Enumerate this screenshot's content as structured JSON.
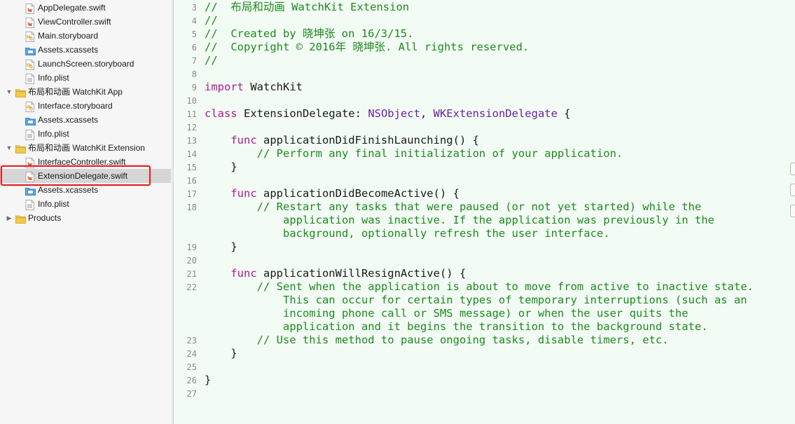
{
  "navigator": {
    "items": [
      {
        "label": "AppDelegate.swift",
        "kind": "swift",
        "depth": 2
      },
      {
        "label": "ViewController.swift",
        "kind": "swift",
        "depth": 2
      },
      {
        "label": "Main.storyboard",
        "kind": "storyboard",
        "depth": 2
      },
      {
        "label": "Assets.xcassets",
        "kind": "assets",
        "depth": 2
      },
      {
        "label": "LaunchScreen.storyboard",
        "kind": "storyboard",
        "depth": 2
      },
      {
        "label": "Info.plist",
        "kind": "plist",
        "depth": 2
      },
      {
        "label": "布局和动画 WatchKit App",
        "kind": "folder",
        "depth": 1,
        "disclosure": "▼"
      },
      {
        "label": "Interface.storyboard",
        "kind": "storyboard",
        "depth": 2
      },
      {
        "label": "Assets.xcassets",
        "kind": "assets",
        "depth": 2
      },
      {
        "label": "Info.plist",
        "kind": "plist",
        "depth": 2
      },
      {
        "label": "布局和动画 WatchKit Extension",
        "kind": "folder",
        "depth": 1,
        "disclosure": "▼"
      },
      {
        "label": "InterfaceController.swift",
        "kind": "swift",
        "depth": 2
      },
      {
        "label": "ExtensionDelegate.swift",
        "kind": "swift",
        "depth": 2,
        "selected": true
      },
      {
        "label": "Assets.xcassets",
        "kind": "assets",
        "depth": 2
      },
      {
        "label": "Info.plist",
        "kind": "plist",
        "depth": 2
      },
      {
        "label": "Products",
        "kind": "folder",
        "depth": 1,
        "disclosure": "▶"
      }
    ]
  },
  "colors": {
    "keyword": "#ab1d8f",
    "comment": "#1c8a1c",
    "type": "#6a22a8",
    "plain": "#1a1a1a",
    "editor_background": "#f3fbf5",
    "selection_outline": "#e02020"
  },
  "editor": {
    "lines": [
      {
        "num": "3",
        "segments": [
          {
            "t": "//  布局和动画 WatchKit Extension",
            "c": "cm"
          }
        ]
      },
      {
        "num": "4",
        "segments": [
          {
            "t": "//",
            "c": "cm"
          }
        ]
      },
      {
        "num": "5",
        "segments": [
          {
            "t": "//  Created by 晓坤张 on 16/3/15.",
            "c": "cm"
          }
        ]
      },
      {
        "num": "6",
        "segments": [
          {
            "t": "//  Copyright © 2016年 晓坤张. All rights reserved.",
            "c": "cm"
          }
        ]
      },
      {
        "num": "7",
        "segments": [
          {
            "t": "//",
            "c": "cm"
          }
        ]
      },
      {
        "num": "8",
        "segments": []
      },
      {
        "num": "9",
        "segments": [
          {
            "t": "import",
            "c": "kw"
          },
          {
            "t": " WatchKit",
            "c": "pl"
          }
        ]
      },
      {
        "num": "10",
        "segments": []
      },
      {
        "num": "11",
        "segments": [
          {
            "t": "class",
            "c": "kw"
          },
          {
            "t": " ExtensionDelegate: ",
            "c": "pl"
          },
          {
            "t": "NSObject",
            "c": "ty"
          },
          {
            "t": ", ",
            "c": "pl"
          },
          {
            "t": "WKExtensionDelegate",
            "c": "ty"
          },
          {
            "t": " {",
            "c": "pl"
          }
        ]
      },
      {
        "num": "12",
        "segments": []
      },
      {
        "num": "13",
        "segments": [
          {
            "t": "    ",
            "c": "pl"
          },
          {
            "t": "func",
            "c": "kw"
          },
          {
            "t": " applicationDidFinishLaunching() {",
            "c": "pl"
          }
        ]
      },
      {
        "num": "14",
        "segments": [
          {
            "t": "        ",
            "c": "pl"
          },
          {
            "t": "// Perform any final initialization of your application.",
            "c": "cm"
          }
        ]
      },
      {
        "num": "15",
        "segments": [
          {
            "t": "    }",
            "c": "pl"
          }
        ]
      },
      {
        "num": "16",
        "segments": []
      },
      {
        "num": "17",
        "segments": [
          {
            "t": "    ",
            "c": "pl"
          },
          {
            "t": "func",
            "c": "kw"
          },
          {
            "t": " applicationDidBecomeActive() {",
            "c": "pl"
          }
        ]
      },
      {
        "num": "18",
        "segments": [
          {
            "t": "        ",
            "c": "pl"
          },
          {
            "t": "// Restart any tasks that were paused (or not yet started) while the",
            "c": "cm"
          }
        ]
      },
      {
        "num": "",
        "segments": [
          {
            "t": "            application was inactive. If the application was previously in the",
            "c": "cm"
          }
        ]
      },
      {
        "num": "",
        "segments": [
          {
            "t": "            background, optionally refresh the user interface.",
            "c": "cm"
          }
        ]
      },
      {
        "num": "19",
        "segments": [
          {
            "t": "    }",
            "c": "pl"
          }
        ]
      },
      {
        "num": "20",
        "segments": []
      },
      {
        "num": "21",
        "segments": [
          {
            "t": "    ",
            "c": "pl"
          },
          {
            "t": "func",
            "c": "kw"
          },
          {
            "t": " applicationWillResignActive() {",
            "c": "pl"
          }
        ]
      },
      {
        "num": "22",
        "segments": [
          {
            "t": "        ",
            "c": "pl"
          },
          {
            "t": "// Sent when the application is about to move from active to inactive state.",
            "c": "cm"
          }
        ]
      },
      {
        "num": "",
        "segments": [
          {
            "t": "            This can occur for certain types of temporary interruptions (such as an",
            "c": "cm"
          }
        ]
      },
      {
        "num": "",
        "segments": [
          {
            "t": "            incoming phone call or SMS message) or when the user quits the",
            "c": "cm"
          }
        ]
      },
      {
        "num": "",
        "segments": [
          {
            "t": "            application and it begins the transition to the background state.",
            "c": "cm"
          }
        ]
      },
      {
        "num": "23",
        "segments": [
          {
            "t": "        ",
            "c": "pl"
          },
          {
            "t": "// Use this method to pause ongoing tasks, disable timers, etc.",
            "c": "cm"
          }
        ]
      },
      {
        "num": "24",
        "segments": [
          {
            "t": "    }",
            "c": "pl"
          }
        ]
      },
      {
        "num": "25",
        "segments": []
      },
      {
        "num": "26",
        "segments": [
          {
            "t": "}",
            "c": "pl"
          }
        ]
      },
      {
        "num": "27",
        "segments": []
      }
    ]
  }
}
